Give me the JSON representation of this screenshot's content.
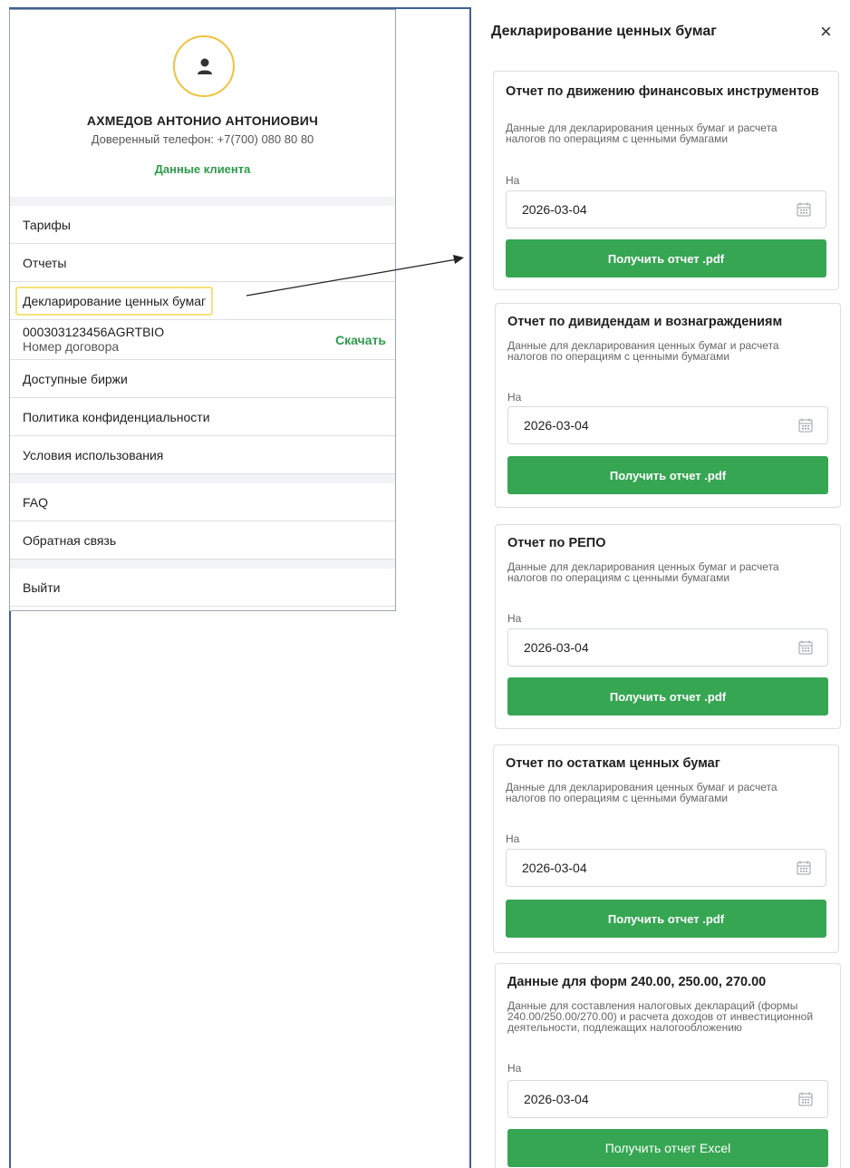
{
  "profile": {
    "name": "АХМЕДОВ АНТОНИО АНТОНИОВИЧ",
    "phone": "Доверенный телефон: +7(700) 080 80 80",
    "client_data_link": "Данные клиента"
  },
  "menu": {
    "tariffs": "Тарифы",
    "reports": "Отчеты",
    "declaration": "Декларирование ценных бумаг",
    "contract_number": "000303123456AGRTBIO",
    "contract_label": "Номер договора",
    "download": "Скачать",
    "exchanges": "Доступные биржи",
    "privacy": "Политика конфиденциальности",
    "terms": "Условия использования",
    "faq": "FAQ",
    "feedback": "Обратная связь",
    "logout": "Выйти"
  },
  "declaration_panel": {
    "title": "Декларирование ценных бумаг",
    "close": "×",
    "reports": [
      {
        "title": "Отчет по движению финансовых инструментов",
        "description": "Данные для декларирования ценных бумаг и расчета налогов по операциям с ценными бумагами",
        "on_label": "На",
        "date": "2026-03-04",
        "button": "Получить отчет .pdf"
      },
      {
        "title": "Отчет по дивидендам и вознаграждениям",
        "description": "Данные для декларирования ценных бумаг и расчета налогов по операциям с ценными бумагами",
        "on_label": "На",
        "date": "2026-03-04",
        "button": "Получить отчет .pdf"
      },
      {
        "title": "Отчет по РЕПО",
        "description": "Данные для декларирования ценных бумаг и расчета налогов по операциям с ценными бумагами",
        "on_label": "На",
        "date": "2026-03-04",
        "button": "Получить отчет .pdf"
      },
      {
        "title": "Отчет по остаткам ценных бумаг",
        "description": "Данные для декларирования ценных бумаг и расчета налогов по операциям с ценными бумагами",
        "on_label": "На",
        "date": "2026-03-04",
        "button": "Получить отчет .pdf"
      },
      {
        "title": "Данные для форм 240.00, 250.00, 270.00",
        "description": "Данные для составления налоговых деклараций (формы 240.00/250.00/270.00) и расчета доходов от инвестиционной деятельности, подлежащих налогообложению",
        "on_label": "На",
        "date": "2026-03-04",
        "button": "Получить отчет Excel"
      }
    ]
  },
  "colors": {
    "accent_green": "#36a653",
    "link_green": "#2e9b4c",
    "avatar_ring": "#f0c23b",
    "highlight_yellow": "#f3e37a"
  }
}
